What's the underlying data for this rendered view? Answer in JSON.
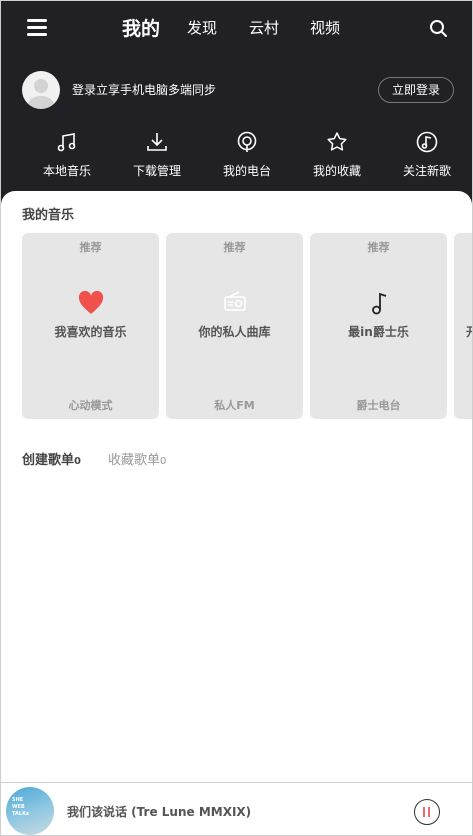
{
  "nav": {
    "tabs": [
      {
        "label": "我的",
        "active": true
      },
      {
        "label": "发现",
        "active": false
      },
      {
        "label": "云村",
        "active": false
      },
      {
        "label": "视频",
        "active": false
      }
    ],
    "menu_icon": "hamburger-menu-icon",
    "search_icon": "search-icon"
  },
  "login": {
    "text": "登录立享手机电脑多端同步",
    "button": "立即登录"
  },
  "quick_actions": [
    {
      "label": "本地音乐",
      "icon": "music-note-icon"
    },
    {
      "label": "下载管理",
      "icon": "download-icon"
    },
    {
      "label": "我的电台",
      "icon": "podcast-icon"
    },
    {
      "label": "我的收藏",
      "icon": "star-icon"
    },
    {
      "label": "关注新歌",
      "icon": "new-song-icon"
    }
  ],
  "my_music": {
    "title": "我的音乐",
    "cards": [
      {
        "tag": "推荐",
        "title": "我喜欢的音乐",
        "subtitle": "心动模式",
        "icon": "heart-icon"
      },
      {
        "tag": "推荐",
        "title": "你的私人曲库",
        "subtitle": "私人FM",
        "icon": "radio-icon"
      },
      {
        "tag": "推荐",
        "title": "最in爵士乐",
        "subtitle": "爵士电台",
        "icon": "music-note-icon"
      },
      {
        "tag": "",
        "title": "开",
        "subtitle": "",
        "icon": ""
      }
    ]
  },
  "playlists": {
    "created_label": "创建歌单",
    "created_count": "0",
    "collected_label": "收藏歌单",
    "collected_count": "0"
  },
  "player": {
    "song": "我们该说话 (Tre Lune MMXIX)",
    "cover_lines": [
      "SHE",
      "WEB",
      "TALKs"
    ],
    "pause_icon": "pause-icon"
  },
  "colors": {
    "header_bg": "#212025",
    "heart": "#f0514c",
    "pause_bar": "#e86e6e"
  }
}
